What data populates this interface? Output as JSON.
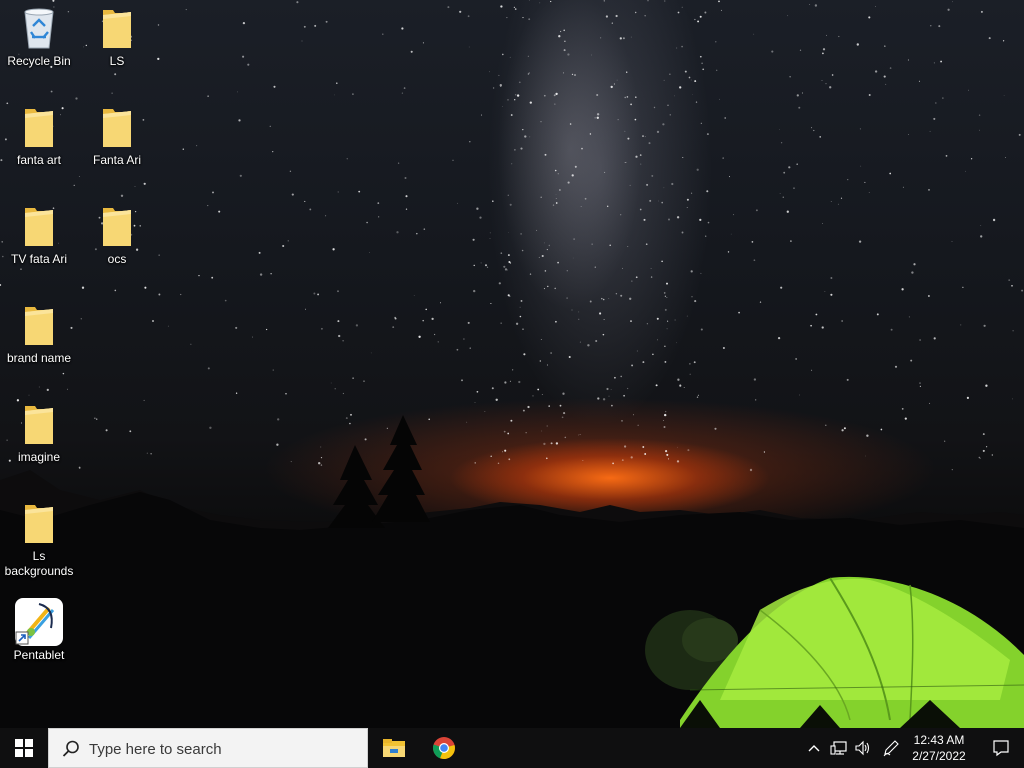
{
  "desktop": {
    "icons": [
      {
        "label": "Recycle Bin",
        "icon": "recycle-bin-icon"
      },
      {
        "label": "LS",
        "icon": "folder-icon"
      },
      {
        "label": "fanta art",
        "icon": "folder-icon"
      },
      {
        "label": "Fanta Ari",
        "icon": "folder-icon"
      },
      {
        "label": "TV  fata Ari",
        "icon": "folder-icon"
      },
      {
        "label": "ocs",
        "icon": "folder-icon"
      },
      {
        "label": "brand name",
        "icon": "folder-icon"
      },
      {
        "label": "imagine",
        "icon": "folder-icon"
      },
      {
        "label": "Ls backgrounds",
        "icon": "folder-icon"
      },
      {
        "label": "Pentablet",
        "icon": "pentablet-shortcut-icon"
      }
    ]
  },
  "taskbar": {
    "start": {
      "icon": "windows-start-icon"
    },
    "search": {
      "placeholder": "Type here to search",
      "icon": "search-icon"
    },
    "pinned": [
      {
        "name": "File Explorer",
        "icon": "file-explorer-icon"
      },
      {
        "name": "Google Chrome",
        "icon": "chrome-icon"
      }
    ],
    "tray": {
      "icons": [
        "chevron-up-icon",
        "network-icon",
        "volume-icon",
        "pen-icon"
      ],
      "time": "12:43 AM",
      "date": "2/27/2022",
      "notification_icon": "action-center-icon"
    }
  },
  "colors": {
    "folder": "#f7d774",
    "taskbar": "#0f0f10",
    "tent": "#9be23a"
  }
}
